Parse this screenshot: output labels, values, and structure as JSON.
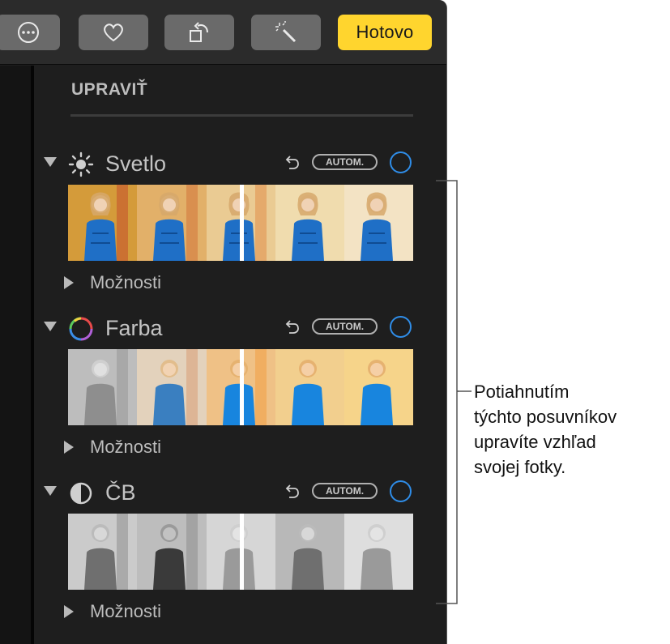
{
  "toolbar": {
    "more_icon": "ellipsis-circle-icon",
    "favorite_icon": "heart-icon",
    "rotate_icon": "rotate-icon",
    "enhance_icon": "magic-wand-icon",
    "done_label": "Hotovo"
  },
  "panel": {
    "title": "UPRAVIŤ",
    "sections": [
      {
        "title": "Svetlo",
        "icon": "sun-icon",
        "auto_label": "AUTOM.",
        "options_label": "Možnosti",
        "strip": "light"
      },
      {
        "title": "Farba",
        "icon": "color-wheel-icon",
        "auto_label": "AUTOM.",
        "options_label": "Možnosti",
        "strip": "color"
      },
      {
        "title": "ČB",
        "icon": "contrast-icon",
        "auto_label": "AUTOM.",
        "options_label": "Možnosti",
        "strip": "bw"
      }
    ]
  },
  "callout": {
    "lines": [
      "Potiahnutím",
      "týchto posuvníkov",
      "upravíte vzhľad",
      "svojej fotky."
    ]
  },
  "colors": {
    "accent_yellow": "#ffd52e",
    "accent_blue": "#2f8de8",
    "panel_bg": "#1e1e1e",
    "toolbar_bg": "#2b2b2b"
  }
}
